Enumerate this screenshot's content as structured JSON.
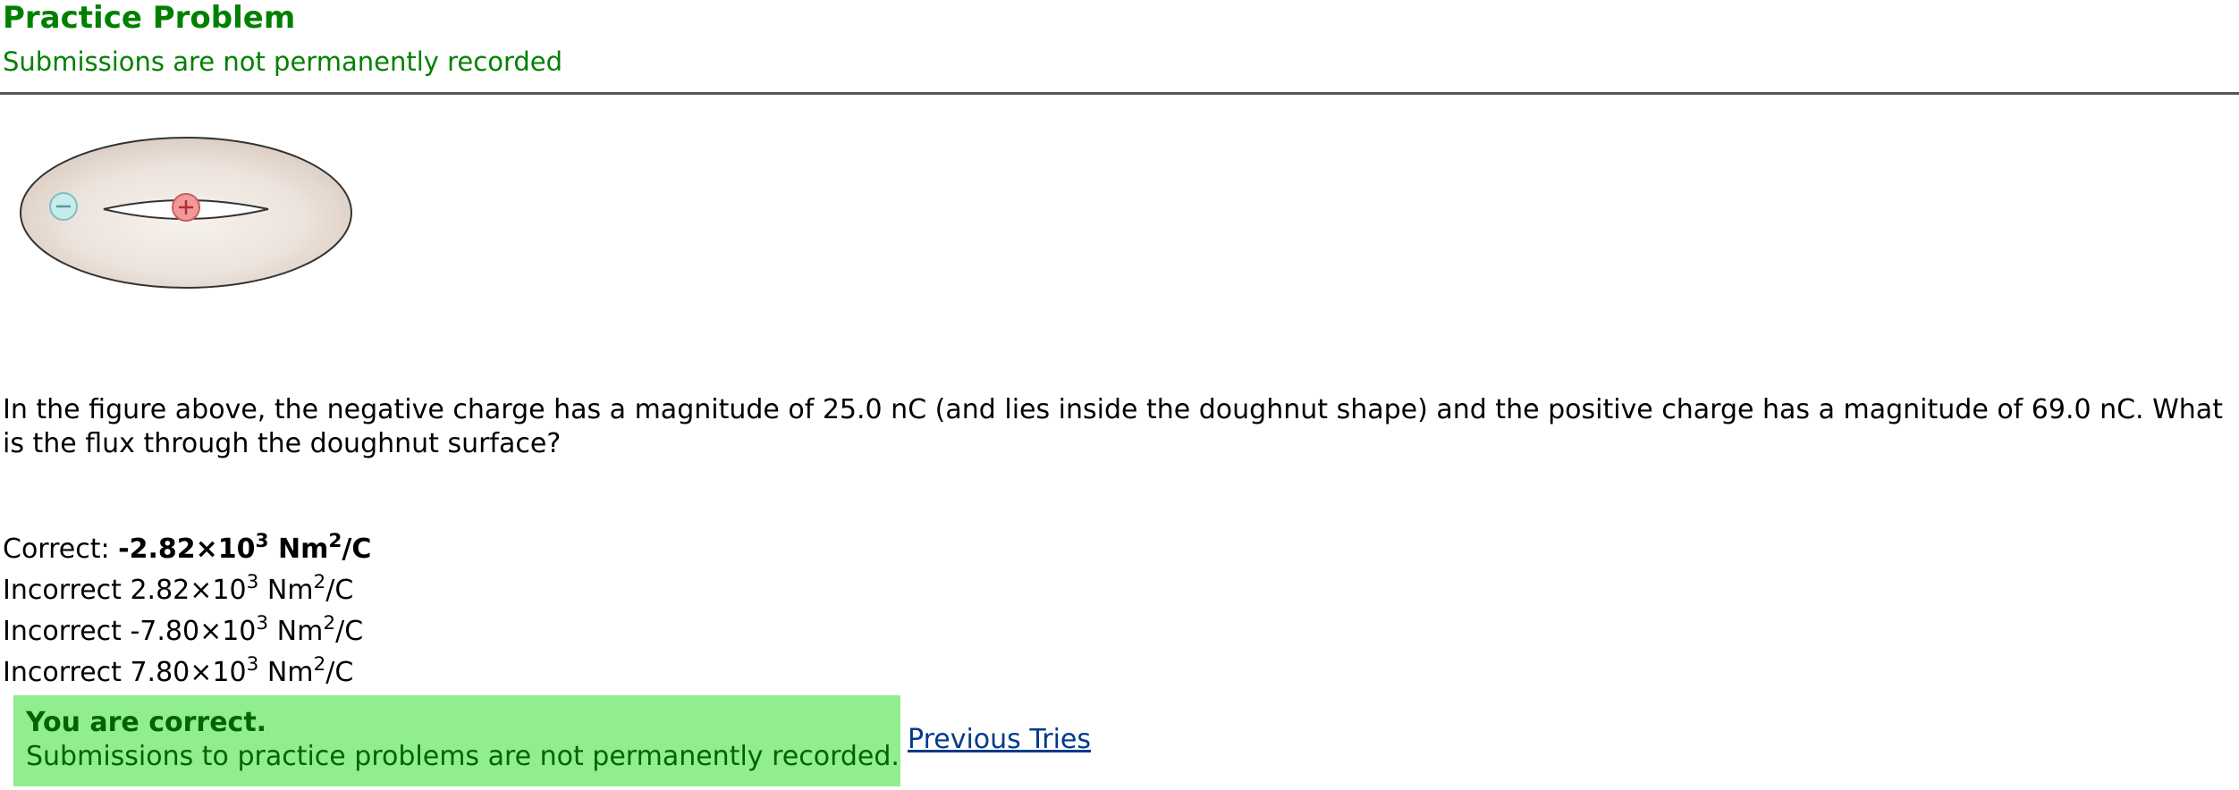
{
  "header": {
    "title": "Practice Problem",
    "subtitle": "Submissions are not permanently recorded"
  },
  "figure": {
    "negative_sign": "−",
    "positive_sign": "+",
    "negative_color": "#bfe6e6",
    "positive_color": "#f08c8c"
  },
  "question": {
    "text": "In the figure above, the negative charge has a magnitude of 25.0 nC (and lies inside the doughnut shape) and the positive charge has a magnitude of 69.0 nC. What is the flux through the doughnut surface?"
  },
  "answers": [
    {
      "status": "Correct:",
      "mantissa": "-2.82×10",
      "exponent": "3",
      "unit_base": " Nm",
      "unit_exp": "2",
      "unit_tail": "/C"
    },
    {
      "status": "Incorrect",
      "mantissa": "2.82×10",
      "exponent": "3",
      "unit_base": " Nm",
      "unit_exp": "2",
      "unit_tail": "/C"
    },
    {
      "status": "Incorrect",
      "mantissa": "-7.80×10",
      "exponent": "3",
      "unit_base": " Nm",
      "unit_exp": "2",
      "unit_tail": "/C"
    },
    {
      "status": "Incorrect",
      "mantissa": "7.80×10",
      "exponent": "3",
      "unit_base": " Nm",
      "unit_exp": "2",
      "unit_tail": "/C"
    }
  ],
  "feedback": {
    "heading": "You are correct.",
    "text": "Submissions to practice problems are not permanently recorded.",
    "background": "#90ee90"
  },
  "links": {
    "previous_tries": "Previous Tries"
  }
}
